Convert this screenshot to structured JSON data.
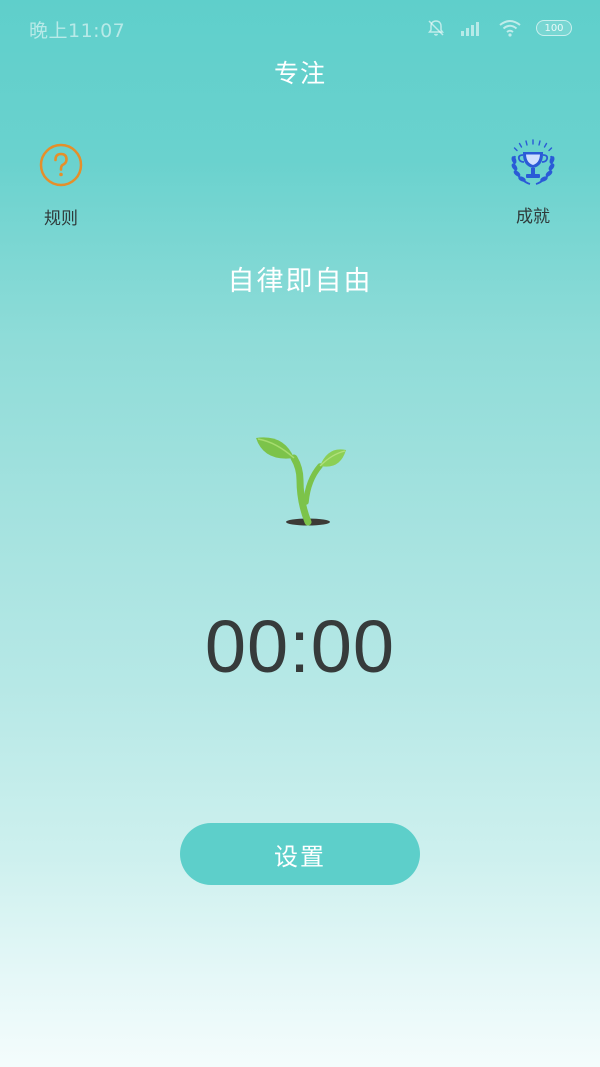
{
  "status_bar": {
    "time": "晚上11:07",
    "battery": "100",
    "icons": [
      "alarm-off-icon",
      "signal-icon",
      "wifi-icon",
      "battery-icon"
    ]
  },
  "header": {
    "title": "专注"
  },
  "rules": {
    "label": "规则",
    "icon": "question-circle-icon"
  },
  "achievements": {
    "label": "成就",
    "icon": "trophy-icon"
  },
  "motto": "自律即自由",
  "plant": {
    "icon": "sprout-icon"
  },
  "timer": "00:00",
  "set_button": {
    "label": "设置"
  },
  "colors": {
    "accent": "#5dcfca",
    "rules_icon": "#e58f2a",
    "trophy_icon": "#2a5bd7",
    "timer_text": "#363b3b"
  }
}
